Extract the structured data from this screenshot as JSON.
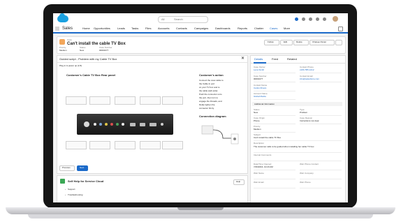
{
  "header": {
    "search_placeholder": "Search",
    "scope": "All"
  },
  "nav": {
    "app_name": "Sales",
    "items": [
      "Home",
      "Opportunities",
      "Leads",
      "Tasks",
      "Files",
      "Accounts",
      "Contacts",
      "Campaigns",
      "Dashboards",
      "Reports",
      "Chatter",
      "Cases",
      "More"
    ]
  },
  "case": {
    "object_label": "Case",
    "title": "Can't install the cable TV Box",
    "buttons": [
      "Follow",
      "Edit",
      "Delete",
      "Change Owner"
    ],
    "fields": [
      {
        "label": "Priority",
        "value": "Medium"
      },
      {
        "label": "Status",
        "value": "New"
      },
      {
        "label": "Case Number",
        "value": "00001077"
      }
    ]
  },
  "guided": {
    "title": "Guided script - Problem with my Cable TV Box",
    "step": "Plug in & power up (1/3)",
    "panel_title": "Customer's Cable TV Box Rear panel",
    "action_title": "Customer's action",
    "action_text": [
      "Connect the coax cable to",
      "the Cable In port",
      "on your TV box and to",
      "the cable wall outlet.",
      "Push the connector onto",
      "the port, then turn to",
      "engage the threads, and",
      "finally tighten the",
      "connector firmly."
    ],
    "connection_title": "Connection diagram",
    "previous": "Previous",
    "next": "Next"
  },
  "selfhelp": {
    "title": "Self Help for Service Cloud",
    "button": "Help",
    "items": [
      "Support",
      "Troubleshooting"
    ]
  },
  "details": {
    "tabs": [
      "Details",
      "Feed",
      "Related"
    ],
    "fields": [
      {
        "label": "Case Owner",
        "value": "Lena Smith"
      },
      {
        "label": "Contact Phone",
        "value": "(415) 555-1212"
      },
      {
        "label": "Case Number",
        "value": "00001077"
      },
      {
        "label": "Contact Email",
        "value": "info@salesforce.com"
      },
      {
        "label": "Contact Name",
        "value": "Carlos Rivera"
      },
      {
        "label": "Account Name",
        "value": "Global Media"
      }
    ],
    "section": "Additional Information",
    "info": [
      {
        "label": "Status",
        "value": "New"
      },
      {
        "label": "Type",
        "value": "Problem"
      },
      {
        "label": "Case Origin",
        "value": "Phone"
      },
      {
        "label": "Case Reason",
        "value": "Instructions not clear"
      },
      {
        "label": "Priority",
        "value": "Medium"
      }
    ],
    "subject_label": "Subject",
    "subject": "Can't install the cable TV Box",
    "description_label": "Description",
    "description": "The customer calls to be guided when installing her cable TV box",
    "internal_label": "Internal Comments",
    "extra": [
      {
        "label": "Date/Time Opened",
        "value": "7/26/2016, 10:20 AM"
      },
      {
        "label": "Web Phone Contact",
        "value": ""
      },
      {
        "label": "Web Name",
        "value": ""
      },
      {
        "label": "Web Company",
        "value": ""
      },
      {
        "label": "Web Email",
        "value": ""
      },
      {
        "label": "Web Phone",
        "value": ""
      }
    ]
  },
  "colors": {
    "brand": "#1b6ac9",
    "case_icon": "#f2a65a",
    "selfhelp_icon": "#3ba755",
    "cloud": "#1ba1e0"
  }
}
